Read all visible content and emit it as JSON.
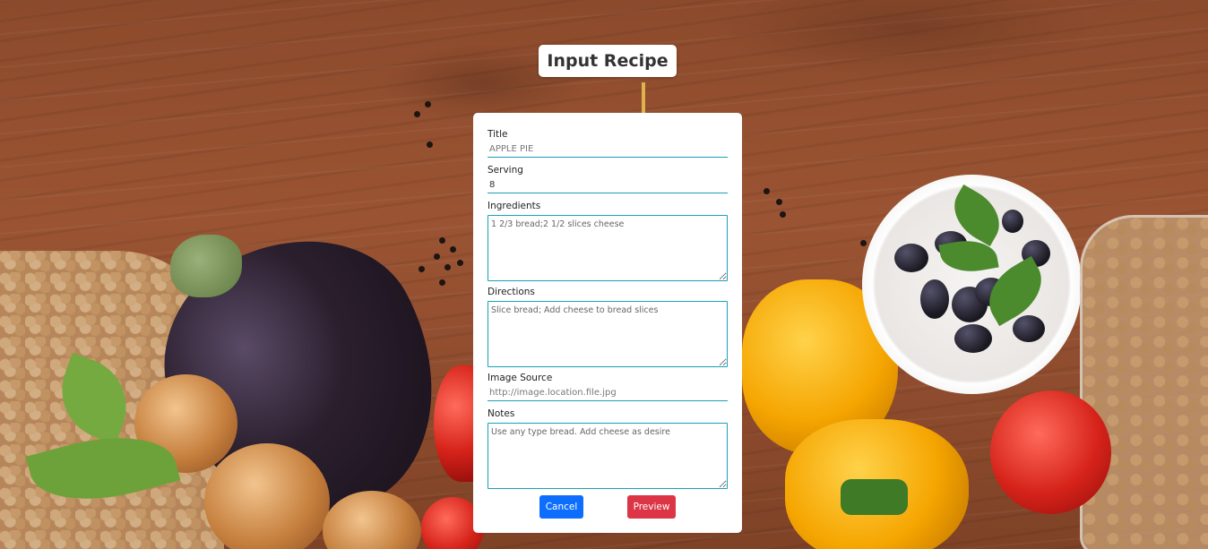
{
  "page": {
    "title": "Input Recipe"
  },
  "form": {
    "title": {
      "label": "Title",
      "placeholder": "APPLE PIE",
      "value": ""
    },
    "serving": {
      "label": "Serving",
      "placeholder": "",
      "value": "8"
    },
    "ingredients": {
      "label": "Ingredients",
      "placeholder": "1 2/3 bread;2 1/2 slices cheese"
    },
    "directions": {
      "label": "Directions",
      "placeholder": "Slice bread; Add cheese to bread slices"
    },
    "image_source": {
      "label": "Image Source",
      "placeholder": "http://image.location.file.jpg"
    },
    "notes": {
      "label": "Notes",
      "placeholder": "Use any type bread. Add cheese as desire"
    }
  },
  "buttons": {
    "cancel": "Cancel",
    "preview": "Preview"
  },
  "colors": {
    "cancel": "#0d6efd",
    "preview": "#dc3545",
    "field_border": "#17a2b8"
  }
}
